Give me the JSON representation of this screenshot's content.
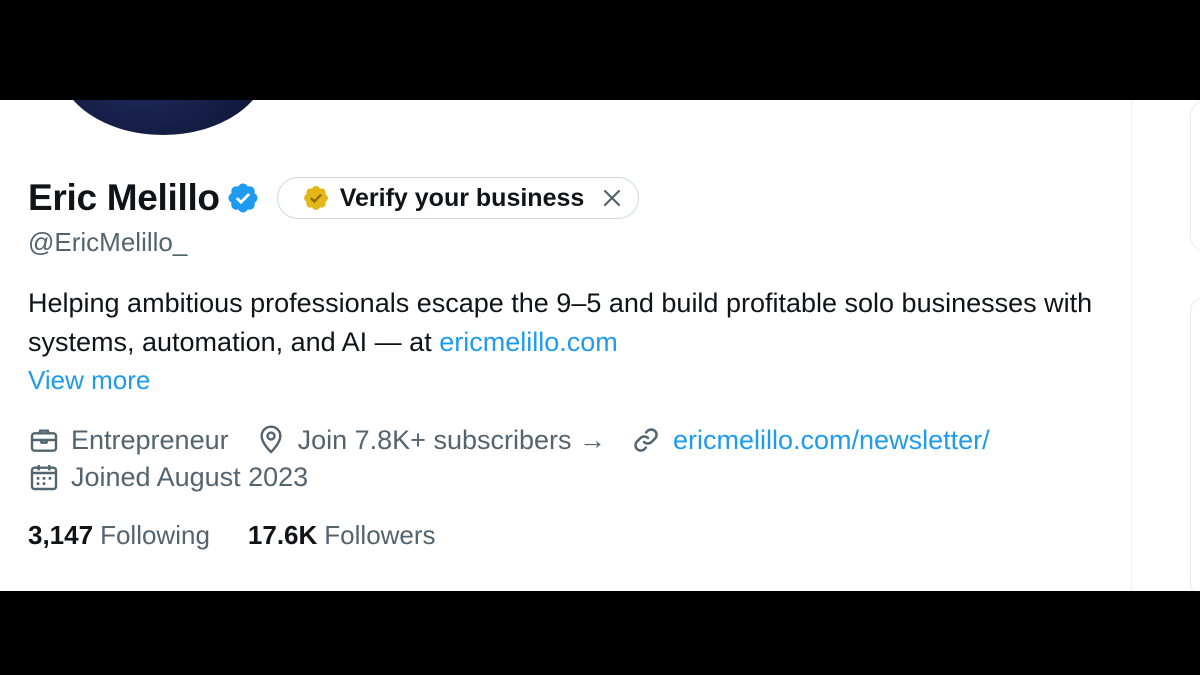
{
  "profile": {
    "display_name": "Eric Melillo",
    "handle": "@EricMelillo_",
    "verified_icon": "verified-badge-blue",
    "verify_pill": {
      "label": "Verify your business",
      "icon": "gold-check-badge",
      "close_icon": "close-x"
    },
    "bio": {
      "text": "Helping ambitious professionals escape the 9–5 and build profitable solo businesses with systems, automation, and AI — at ",
      "link": "ericmelillo.com"
    },
    "view_more": "View more",
    "meta": {
      "profession": {
        "icon": "briefcase-icon",
        "text": "Entrepreneur"
      },
      "location": {
        "icon": "location-pin-icon",
        "text": "Join 7.8K+ subscribers →"
      },
      "website": {
        "icon": "link-icon",
        "text": "ericmelillo.com/newsletter/"
      },
      "joined": {
        "icon": "calendar-icon",
        "text": "Joined August 2023"
      }
    },
    "stats": {
      "following": {
        "count": "3,147",
        "label": "Following"
      },
      "followers": {
        "count": "17.6K",
        "label": "Followers"
      }
    }
  },
  "colors": {
    "accent": "#1d9bf0",
    "text_primary": "#0f1419",
    "text_secondary": "#536471",
    "gold": "#e2b719",
    "letterbox": "#000000"
  }
}
